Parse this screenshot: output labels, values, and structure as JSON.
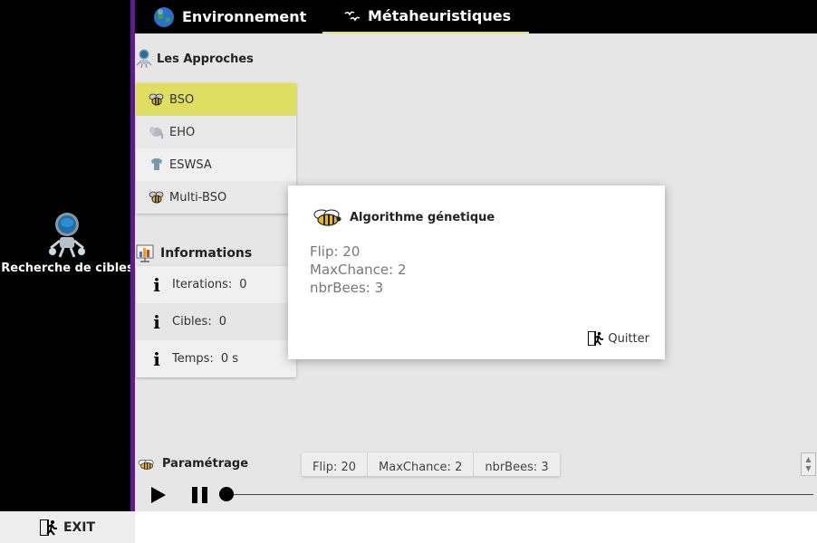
{
  "sidebar": {
    "app_label": "Recherche de cibles",
    "exit_label": "EXIT"
  },
  "tabs": [
    {
      "label": "Environnement",
      "icon": "globe-icon"
    },
    {
      "label": "Métaheuristiques",
      "icon": "birds-icon",
      "active": true
    }
  ],
  "approaches": {
    "title": "Les Approches",
    "items": [
      {
        "label": "BSO",
        "icon": "bee-icon",
        "selected": true
      },
      {
        "label": "EHO",
        "icon": "elephant-icon"
      },
      {
        "label": "ESWSA",
        "icon": "elephant-icon"
      },
      {
        "label": "Multi-BSO",
        "icon": "bee-icon"
      }
    ]
  },
  "informations": {
    "title": "Informations",
    "items": [
      {
        "label": "Iterations:",
        "value": "0"
      },
      {
        "label": "Cibles:",
        "value": "0"
      },
      {
        "label": "Temps:",
        "value": "0 s"
      }
    ]
  },
  "dialog": {
    "title": "Algorithme génetique",
    "lines": [
      "Flip: 20",
      "MaxChance: 2",
      "nbrBees: 3"
    ],
    "quit_label": "Quitter"
  },
  "parametrage": {
    "title": "Paramétrage",
    "chips": [
      "Flip: 20",
      "MaxChance: 2",
      "nbrBees: 3"
    ]
  },
  "colors": {
    "selected": "#dede62",
    "accent_purple": "#5a1f8a",
    "tab_underline": "#d8e07a"
  }
}
